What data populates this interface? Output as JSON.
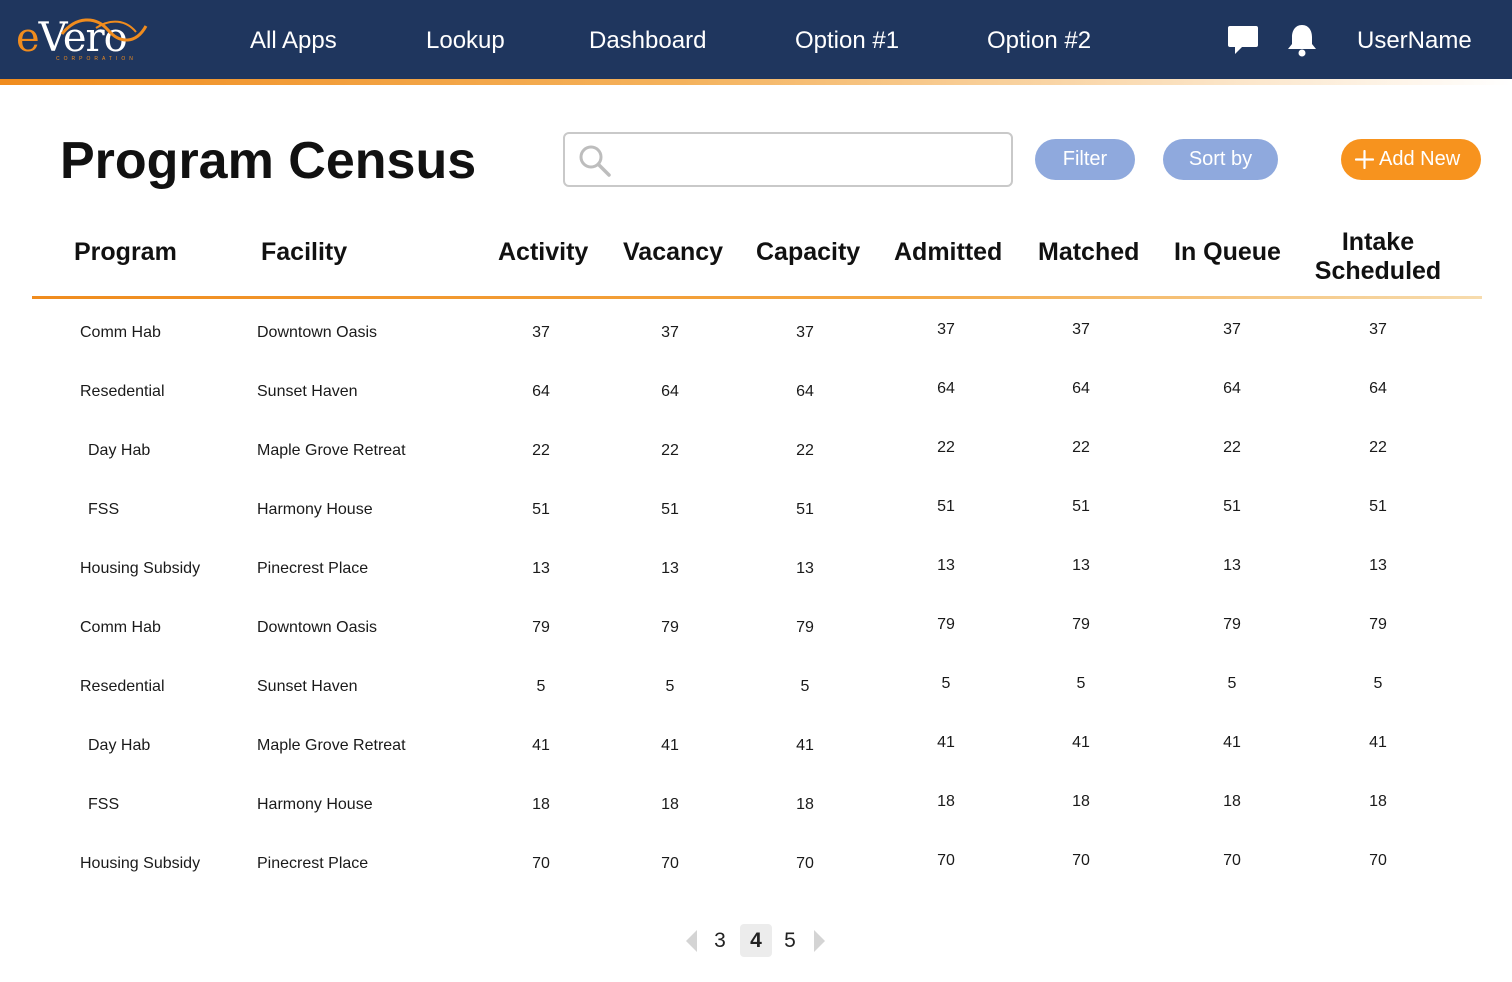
{
  "app": {
    "logo_text_e": "e",
    "logo_text_rest": "Vero",
    "logo_subtext": "CORPORATION"
  },
  "nav": {
    "items": [
      {
        "label": "All Apps"
      },
      {
        "label": "Lookup"
      },
      {
        "label": "Dashboard"
      },
      {
        "label": "Option #1"
      },
      {
        "label": "Option #2"
      }
    ],
    "username": "UserName",
    "icons": [
      "chat-icon",
      "bell-icon"
    ]
  },
  "page": {
    "title": "Program Census",
    "search_placeholder": "",
    "search_value": "",
    "filter_label": "Filter",
    "sort_label": "Sort by",
    "add_label": "Add New",
    "add_icon": "plus-icon"
  },
  "colors": {
    "topbar": "#1f365e",
    "accent_orange": "#f7931e",
    "pill_blue": "#8fa9dd"
  },
  "table": {
    "columns": [
      "Program",
      "Facility",
      "Activity",
      "Vacancy",
      "Capacity",
      "Admitted",
      "Matched",
      "In Queue",
      "Intake Scheduled"
    ],
    "intake_line1": "Intake",
    "intake_line2": "Scheduled",
    "rows": [
      [
        "Comm Hab",
        "Downtown Oasis",
        "37",
        "37",
        "37",
        "37",
        "37",
        "37",
        "37"
      ],
      [
        "Resedential",
        "Sunset Haven",
        "64",
        "64",
        "64",
        "64",
        "64",
        "64",
        "64"
      ],
      [
        "Day Hab",
        "Maple Grove Retreat",
        "22",
        "22",
        "22",
        "22",
        "22",
        "22",
        "22"
      ],
      [
        "FSS",
        "Harmony House",
        "51",
        "51",
        "51",
        "51",
        "51",
        "51",
        "51"
      ],
      [
        "Housing Subsidy",
        "Pinecrest Place",
        "13",
        "13",
        "13",
        "13",
        "13",
        "13",
        "13"
      ],
      [
        "Comm Hab",
        "Downtown Oasis",
        "79",
        "79",
        "79",
        "79",
        "79",
        "79",
        "79"
      ],
      [
        "Resedential",
        "Sunset Haven",
        "5",
        "5",
        "5",
        "5",
        "5",
        "5",
        "5"
      ],
      [
        "Day Hab",
        "Maple Grove Retreat",
        "41",
        "41",
        "41",
        "41",
        "41",
        "41",
        "41"
      ],
      [
        "FSS",
        "Harmony House",
        "18",
        "18",
        "18",
        "18",
        "18",
        "18",
        "18"
      ],
      [
        "Housing Subsidy",
        "Pinecrest Place",
        "70",
        "70",
        "70",
        "70",
        "70",
        "70",
        "70"
      ]
    ]
  },
  "pagination": {
    "pages": [
      "3",
      "4",
      "5"
    ],
    "current": "4"
  }
}
